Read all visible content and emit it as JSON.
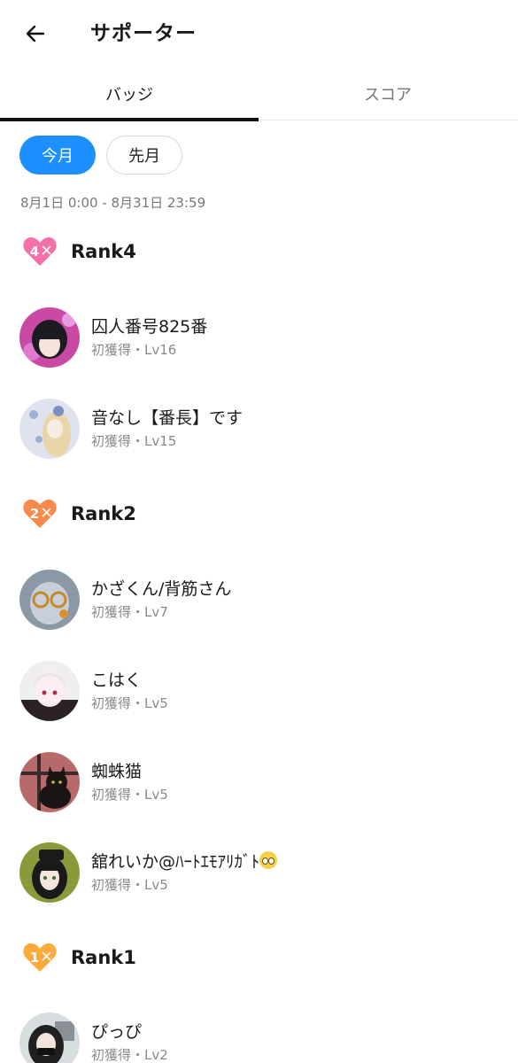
{
  "header": {
    "title": "サポーター"
  },
  "tabs": [
    {
      "label": "バッジ"
    },
    {
      "label": "スコア"
    }
  ],
  "chips": {
    "current": "今月",
    "previous": "先月"
  },
  "period": "8月1日 0:00 - 8月31日 23:59",
  "groups": [
    {
      "rank_label": "Rank4",
      "rank_number": "4",
      "badge_color": "#f470a8",
      "users": [
        {
          "name": "囚人番号825番",
          "sub": "初獲得・Lv16"
        },
        {
          "name": "音なし【番長】です",
          "sub": "初獲得・Lv15"
        }
      ]
    },
    {
      "rank_label": "Rank2",
      "rank_number": "2",
      "badge_color": "#fb8a4a",
      "users": [
        {
          "name": "かざくん/背筋さん",
          "sub": "初獲得・Lv7"
        },
        {
          "name": "こはく",
          "sub": "初獲得・Lv5"
        },
        {
          "name": "蜘蛛猫",
          "sub": "初獲得・Lv5"
        },
        {
          "name": "舘れいか@ﾊｰﾄｴﾓｱﾘｶﾞﾄ",
          "sub": "初獲得・Lv5"
        }
      ]
    },
    {
      "rank_label": "Rank1",
      "rank_number": "1",
      "badge_color": "#ffa93a",
      "users": [
        {
          "name": "ぴっぴ",
          "sub": "初獲得・Lv2"
        }
      ]
    }
  ],
  "colors": {
    "accent": "#1e8fff"
  }
}
